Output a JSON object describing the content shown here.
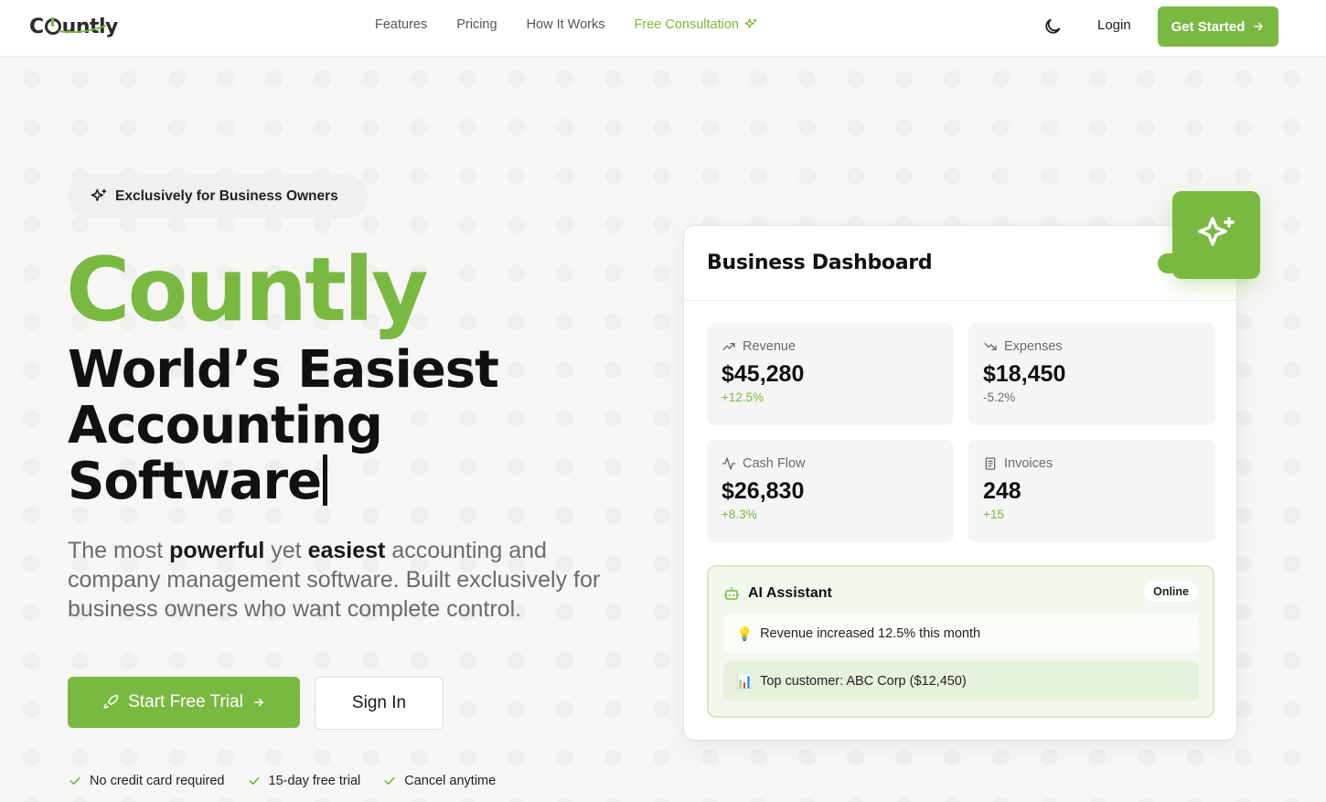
{
  "nav": {
    "logo": "Countly",
    "links": [
      "Features",
      "Pricing",
      "How It Works"
    ],
    "consultation": "Free Consultation",
    "login": "Login",
    "cta": "Get Started"
  },
  "hero": {
    "badge": "Exclusively for Business Owners",
    "brand": "Countly",
    "headline_1": "World’s Easiest",
    "headline_2": "Accounting",
    "headline_3": "Software",
    "desc_1": "The most ",
    "desc_b1": "powerful",
    "desc_2": " yet ",
    "desc_b2": "easiest",
    "desc_3": " accounting and company management software. Built exclusively for business owners who want complete control.",
    "trial_button": "Start Free Trial",
    "signin_button": "Sign In",
    "perks": [
      "No credit card required",
      "15-day free trial",
      "Cancel anytime"
    ]
  },
  "dashboard": {
    "title": "Business Dashboard",
    "stats": [
      {
        "label": "Revenue",
        "value": "$45,280",
        "delta": "+12.5%",
        "icon": "trending-up-icon"
      },
      {
        "label": "Expenses",
        "value": "$18,450",
        "delta": "-5.2%",
        "icon": "trending-down-icon"
      },
      {
        "label": "Cash Flow",
        "value": "$26,830",
        "delta": "+8.3%",
        "icon": "activity-icon"
      },
      {
        "label": "Invoices",
        "value": "248",
        "delta": "+15",
        "icon": "receipt-icon"
      }
    ],
    "ai": {
      "title": "AI Assistant",
      "status": "Online",
      "messages": [
        {
          "icon": "💡",
          "text": "Revenue increased 12.5% this month"
        },
        {
          "icon": "📊",
          "text": "Top customer: ABC Corp ($12,450)"
        }
      ]
    }
  },
  "colors": {
    "accent": "#79b941",
    "positive": "#79b941",
    "negative": "#6b6b6b"
  }
}
